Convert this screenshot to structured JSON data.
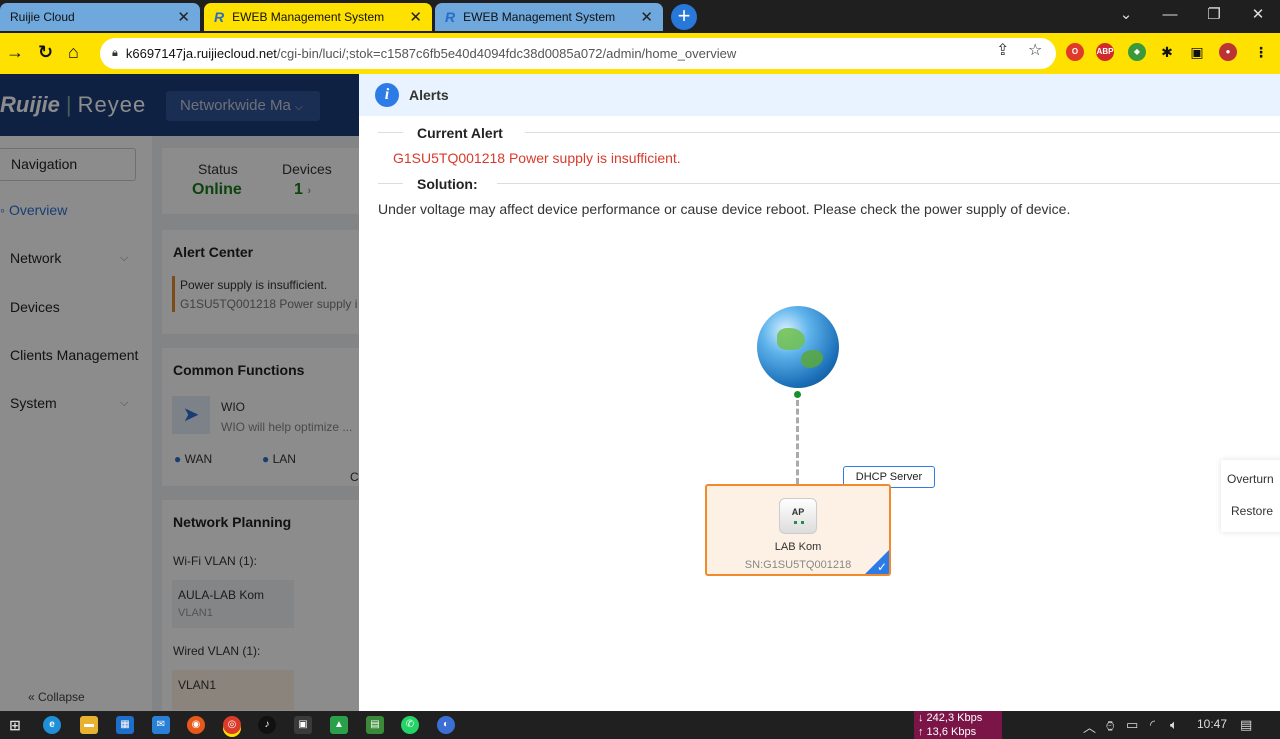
{
  "browser": {
    "tabs": [
      {
        "title": "Ruijie Cloud",
        "active": false
      },
      {
        "title": "EWEB Management System",
        "active": true
      },
      {
        "title": "EWEB Management System",
        "active": false
      }
    ],
    "new_tab": "+",
    "url_host": "k6697147ja.ruijiecloud.net",
    "url_path": "/cgi-bin/luci/;stok=c1587c6fb5e40d4094fdc38d0085a072/admin/home_overview"
  },
  "app": {
    "logo_brand": "Ruijie",
    "logo_product": "Reyee",
    "network_select": "Networkwide Ma",
    "sidebar": {
      "nav_label": "Navigation",
      "items": [
        "Overview",
        "Network",
        "Devices",
        "Clients Management",
        "System"
      ],
      "collapse": "Collapse"
    },
    "status": {
      "status_label": "Status",
      "status_value": "Online",
      "devices_label": "Devices",
      "devices_value": "1"
    },
    "alert_center": {
      "title": "Alert Center",
      "line1": "Power supply is insufficient.",
      "line2": "G1SU5TQ001218 Power supply i"
    },
    "common_functions": {
      "title": "Common Functions",
      "wio_title": "WIO",
      "wio_desc": "WIO will help optimize ...",
      "legend": [
        "WAN",
        "LAN"
      ],
      "legend_extra": "C"
    },
    "network_planning": {
      "title": "Network Planning",
      "wifi_vlan_label": "Wi-Fi VLAN (1):",
      "wifi_ssid": "AULA-LAB Kom",
      "wifi_vlan": "VLAN1",
      "wired_vlan_label": "Wired VLAN (1):",
      "wired_vlan": "VLAN1"
    }
  },
  "alerts_panel": {
    "title": "Alerts",
    "current_alert_label": "Current Alert",
    "alert_message": "G1SU5TQ001218 Power supply is insufficient.",
    "solution_label": "Solution:",
    "solution_text": "Under voltage may affect device performance or cause device reboot. Please check the power supply of device.",
    "topology": {
      "dhcp_tag": "DHCP Server",
      "device_type": "AP",
      "device_name": "LAB  Kom",
      "device_sn": "SN:G1SU5TQ001218"
    },
    "side_buttons": [
      "Overturn",
      "Restore"
    ]
  },
  "taskbar": {
    "download": "↓ 242,3 Kbps",
    "upload": "↑ 13,6 Kbps",
    "time": "10:47"
  },
  "colors": {
    "tab_active": "#ffe100",
    "alert_red": "#d93a2b",
    "accent_blue": "#2d7be6",
    "device_border": "#f08a2a",
    "online_green": "#1a7a1a"
  }
}
